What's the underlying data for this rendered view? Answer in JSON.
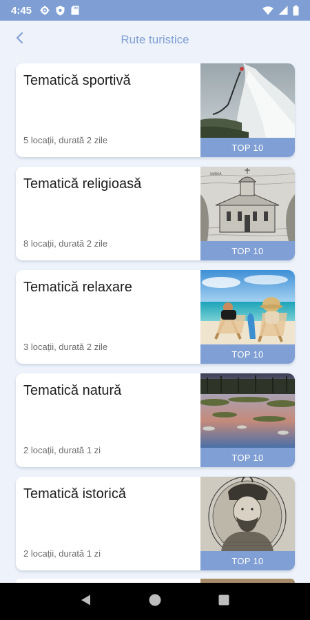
{
  "status_bar": {
    "time": "4:45",
    "left_icons": [
      "gear-icon",
      "shield-icon",
      "sd-card-icon"
    ],
    "right_icons": [
      "wifi-icon",
      "signal-icon",
      "battery-icon"
    ]
  },
  "app_bar": {
    "title": "Rute turistice",
    "back_icon": "chevron-left-icon"
  },
  "routes": [
    {
      "title": "Tematică sportivă",
      "meta": "5 locații, durată 2 zile",
      "badge": "TOP 10",
      "image": "waterfall-photo"
    },
    {
      "title": "Tematică religioasă",
      "meta": "8 locații, durată 2 zile",
      "badge": "TOP 10",
      "image": "church-engraving"
    },
    {
      "title": "Tematică relaxare",
      "meta": "3 locații, durată 2 zile",
      "badge": "TOP 10",
      "image": "beach-photo"
    },
    {
      "title": "Tematică natură",
      "meta": "2 locații, durată 1 zi",
      "badge": "TOP 10",
      "image": "river-delta-photo"
    },
    {
      "title": "Tematică istorică",
      "meta": "2 locații, durată 1 zi",
      "badge": "TOP 10",
      "image": "historical-portrait"
    }
  ],
  "nav_bar": {
    "back": "back-triangle-icon",
    "home": "home-circle-icon",
    "recents": "recents-square-icon"
  },
  "colors": {
    "accent": "#7f9fd4",
    "background": "#eef3fb",
    "card": "#ffffff",
    "badge": "#809fd4"
  }
}
